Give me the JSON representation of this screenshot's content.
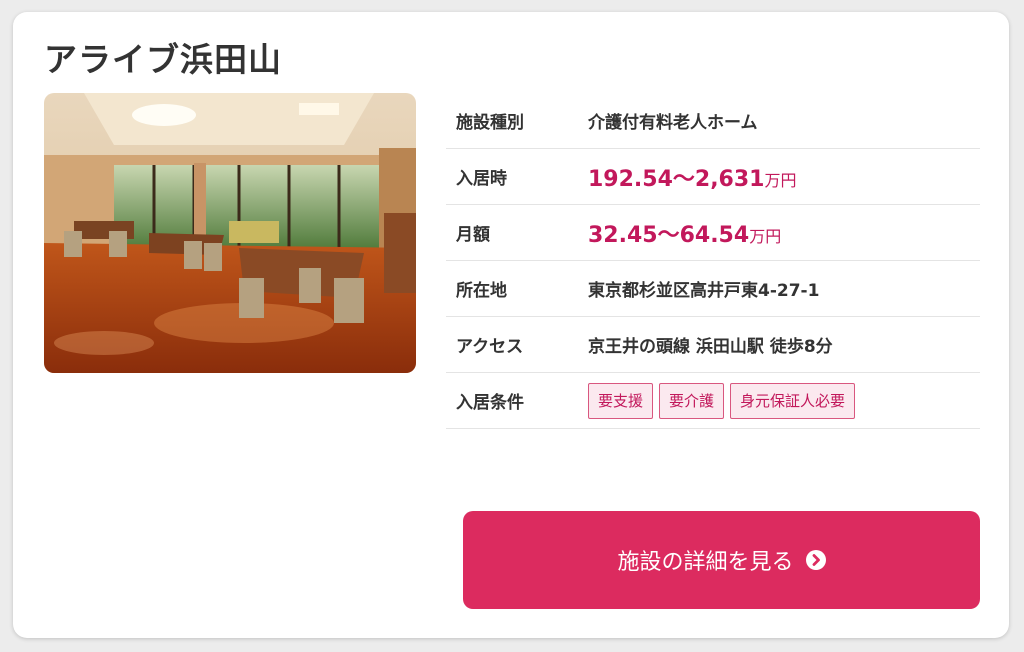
{
  "facility": {
    "name": "アライブ浜田山",
    "photo_icon": "facility-interior-photo"
  },
  "details": [
    {
      "label": "施設種別",
      "value": "介護付有料老人ホーム"
    },
    {
      "label": "入居時",
      "price": "192.54〜2,631",
      "unit": "万円"
    },
    {
      "label": "月額",
      "price": "32.45〜64.54",
      "unit": "万円"
    },
    {
      "label": "所在地",
      "value": "東京都杉並区高井戸東4-27-1"
    },
    {
      "label": "アクセス",
      "value": "京王井の頭線 浜田山駅 徒歩8分"
    },
    {
      "label": "入居条件",
      "tags": [
        "要支援",
        "要介護",
        "身元保証人必要"
      ]
    }
  ],
  "button": {
    "label": "施設の詳細を見る",
    "icon": "chevron-right-circle-icon"
  },
  "colors": {
    "accent": "#dc2b5f",
    "price": "#c2185b",
    "tag_background": "#fbe9ef"
  }
}
